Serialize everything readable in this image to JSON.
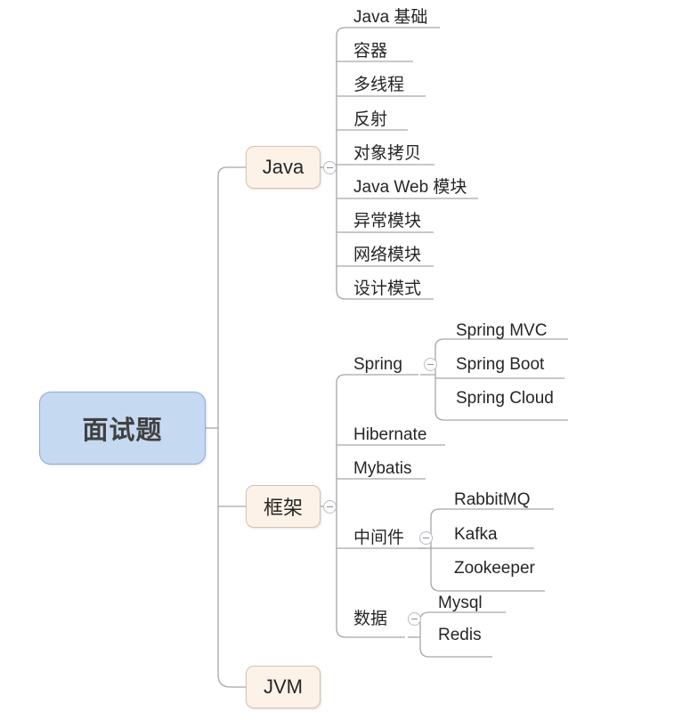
{
  "diagram": {
    "type": "mind-map",
    "title": "面试题",
    "colors": {
      "root_fill": "#c5d9f1",
      "root_border": "#8faadc",
      "branch_fill": "#fcf2e8",
      "branch_border": "#d6c3ae",
      "text": "#262626",
      "connector": "#a6a6a6",
      "toggle_border": "#b8bcc4",
      "background": "#ffffff"
    },
    "root": {
      "label": "面试题"
    },
    "branches": [
      {
        "label": "Java",
        "collapsible": true,
        "children": [
          {
            "label": "Java 基础"
          },
          {
            "label": "容器"
          },
          {
            "label": "多线程"
          },
          {
            "label": "反射"
          },
          {
            "label": "对象拷贝"
          },
          {
            "label": "Java Web 模块"
          },
          {
            "label": "异常模块"
          },
          {
            "label": "网络模块"
          },
          {
            "label": "设计模式"
          }
        ]
      },
      {
        "label": "框架",
        "collapsible": true,
        "children": [
          {
            "label": "Spring",
            "collapsible": true,
            "children": [
              {
                "label": "Spring MVC"
              },
              {
                "label": "Spring Boot"
              },
              {
                "label": "Spring Cloud"
              }
            ]
          },
          {
            "label": "Hibernate"
          },
          {
            "label": "Mybatis"
          },
          {
            "label": "中间件",
            "collapsible": true,
            "children": [
              {
                "label": "RabbitMQ"
              },
              {
                "label": "Kafka"
              },
              {
                "label": "Zookeeper"
              }
            ]
          },
          {
            "label": "数据",
            "collapsible": true,
            "children": [
              {
                "label": "Mysql"
              },
              {
                "label": "Redis"
              }
            ]
          }
        ]
      },
      {
        "label": "JVM",
        "collapsible": false,
        "children": []
      }
    ]
  }
}
